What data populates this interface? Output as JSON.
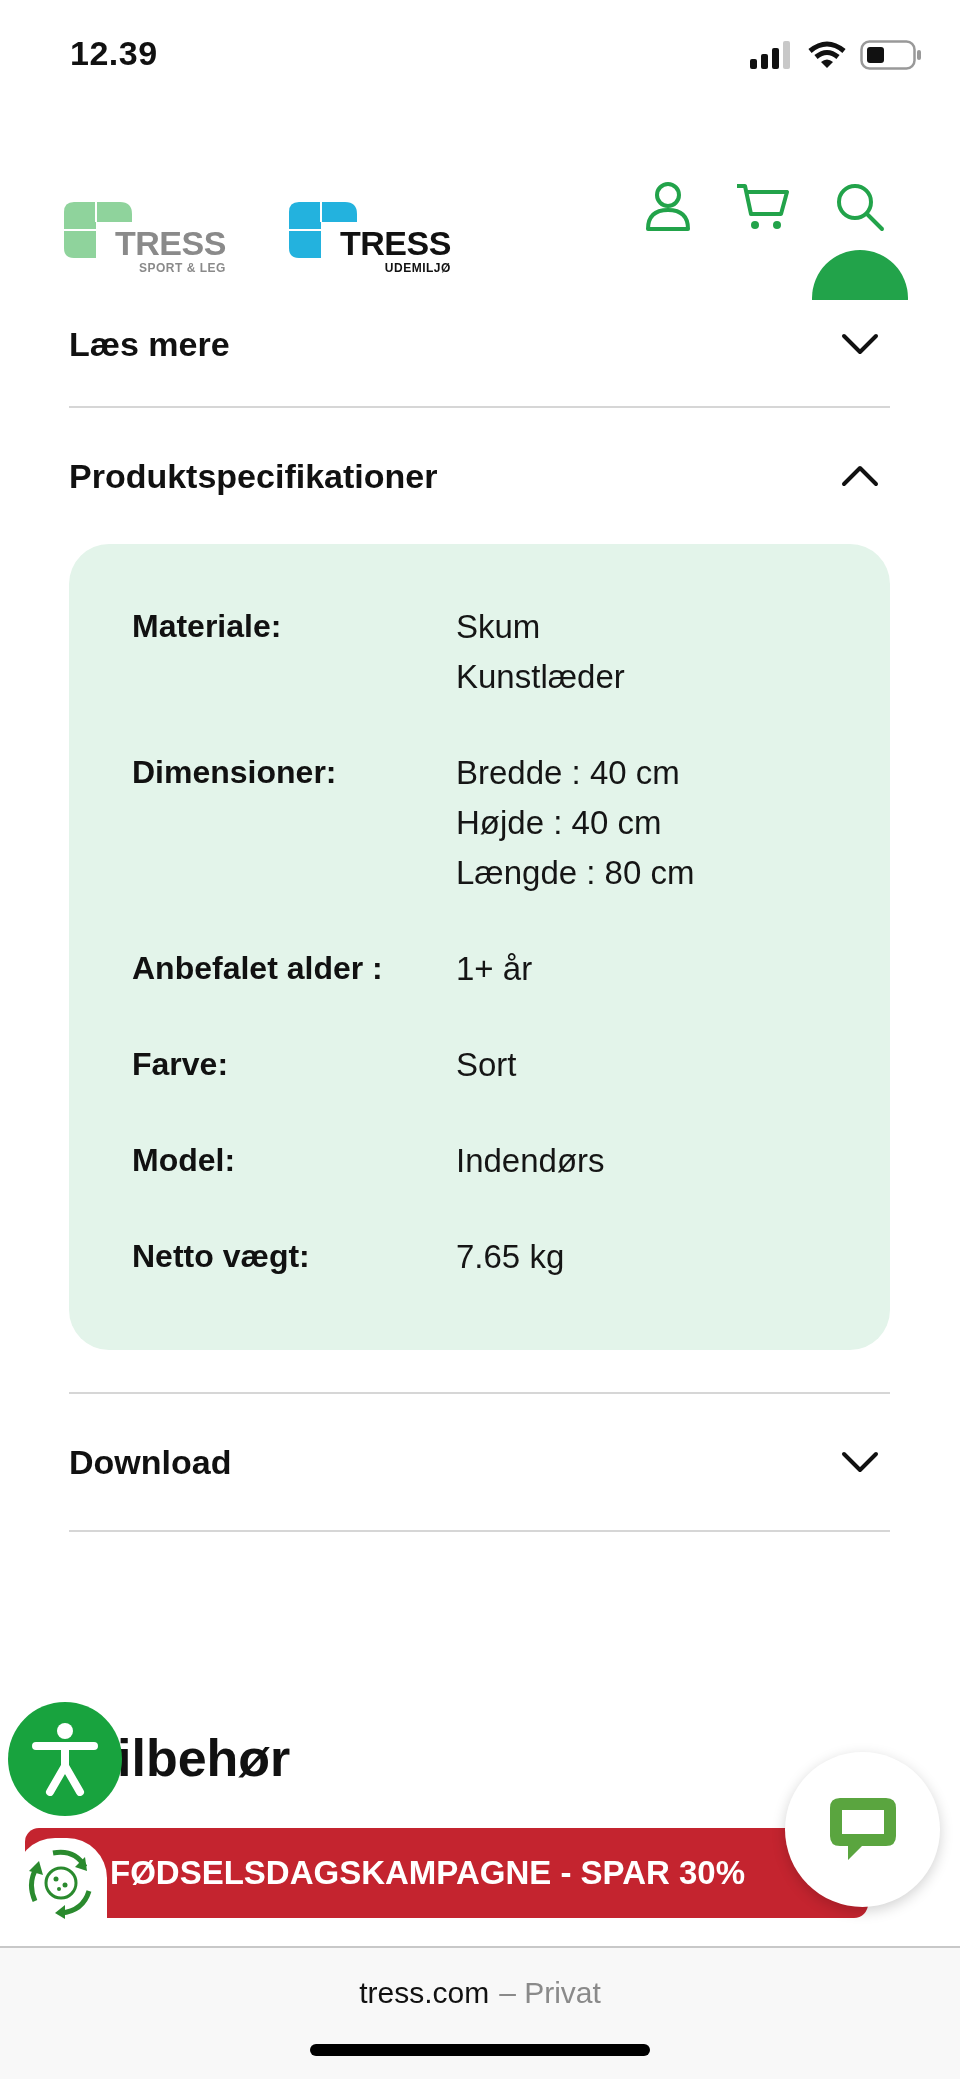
{
  "status_bar": {
    "time": "12.39"
  },
  "header": {
    "logos": [
      {
        "kind": "sport",
        "name": "TRESS",
        "subtitle": "SPORT & LEG"
      },
      {
        "kind": "outdoor",
        "name": "TRESS",
        "subtitle": "UDEMILJØ"
      }
    ]
  },
  "accordion": [
    {
      "title": "Læs mere",
      "expanded": false
    },
    {
      "title": "Produktspecifikationer",
      "expanded": true,
      "specs": [
        {
          "label": "Materiale:",
          "values": [
            "Skum",
            "Kunstlæder"
          ]
        },
        {
          "label": "Dimensioner:",
          "values": [
            "Bredde : 40 cm",
            "Højde : 40 cm",
            "Længde : 80 cm"
          ]
        },
        {
          "label": "Anbefalet alder :",
          "values": [
            "1+ år"
          ]
        },
        {
          "label": "Farve:",
          "values": [
            "Sort"
          ]
        },
        {
          "label": "Model:",
          "values": [
            "Indendørs"
          ]
        },
        {
          "label": "Netto vægt:",
          "values": [
            "7.65 kg"
          ]
        }
      ]
    },
    {
      "title": "Download",
      "expanded": false
    }
  ],
  "section_heading": "ilbehør",
  "promo_banner": {
    "text": "FØDSELSDAGSKAMPAGNE - SPAR 30%"
  },
  "browser_bar": {
    "domain": "tress.com",
    "mode": "– Privat"
  }
}
